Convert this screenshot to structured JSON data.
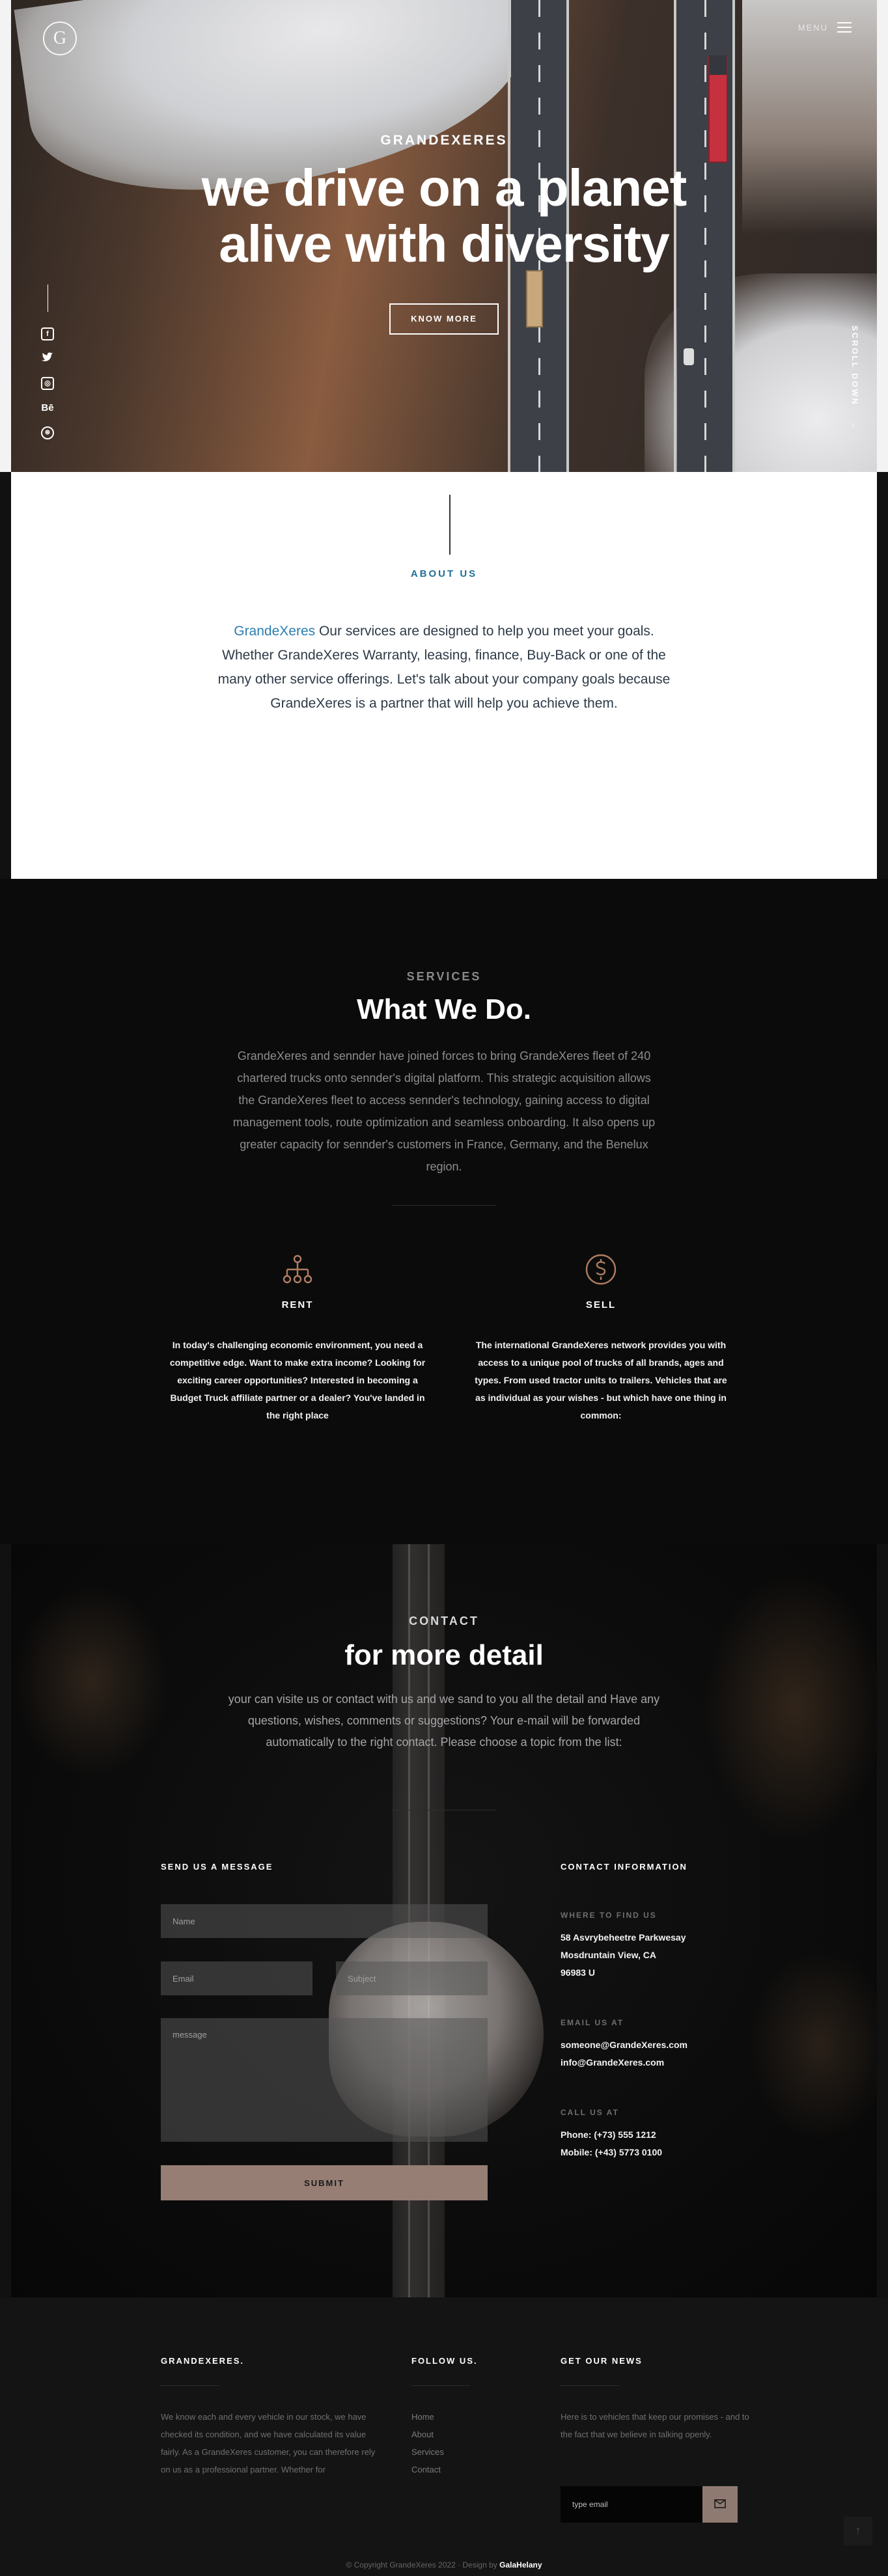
{
  "hero": {
    "brand": "GRANDEXERES",
    "title_line1": "we drive on a planet",
    "title_line2": "alive with diversity",
    "button": "KNOW MORE",
    "menu_label": "MENU",
    "logo_letter": "G",
    "scroll_label": "SCROLL DOWN",
    "scroll_arrow": "→",
    "social": [
      "facebook-icon",
      "twitter-icon",
      "instagram-icon",
      "behance-icon",
      "dribbble-icon"
    ],
    "social_glyphs": [
      "f",
      "🐦",
      "◎",
      "Bē",
      "⊛"
    ]
  },
  "about": {
    "label": "ABOUT US",
    "brand_word": "GrandeXeres",
    "text": " Our services are designed to help you meet your goals. Whether GrandeXeres Warranty, leasing, finance, Buy-Back or one of the many other service offerings. Let's talk about your company goals because GrandeXeres is a partner that will help you achieve them."
  },
  "services": {
    "eyebrow": "SERVICES",
    "title": "What We Do.",
    "lead": "GrandeXeres and sennder have joined forces to bring GrandeXeres fleet of 240 chartered trucks onto sennder's digital platform. This strategic acquisition allows the GrandeXeres fleet to access sennder's technology, gaining access to digital management tools, route optimization and seamless onboarding. It also opens up greater capacity for sennder's customers in France, Germany, and the Benelux region.",
    "items": [
      {
        "title": "RENT",
        "icon": "hierarchy-icon",
        "text": "In today's challenging economic environment, you need a competitive edge. Want to make extra income? Looking for exciting career opportunities? Interested in becoming a Budget Truck affiliate partner or a dealer? You've landed in the right place"
      },
      {
        "title": "SELL",
        "icon": "dollar-coin-icon",
        "text": "The international GrandeXeres network provides you with access to a unique pool of trucks of all brands, ages and types. From used tractor units to trailers. Vehicles that are as individual as your wishes - but which have one thing in common:"
      }
    ]
  },
  "contact": {
    "eyebrow": "CONTACT",
    "title": "for more detail",
    "lead": "your can visite us or contact with us and we sand to you all the detail and Have any questions, wishes, comments or suggestions? Your e-mail will be forwarded automatically to the right contact. Please choose a topic from the list:",
    "form": {
      "title": "SEND US A MESSAGE",
      "name_placeholder": "Name",
      "email_placeholder": "Email",
      "subject_placeholder": "Subject",
      "message_placeholder": "message",
      "submit": "SUBMIT"
    },
    "info": {
      "title": "CONTACT INFORMATION",
      "where_label": "WHERE TO FIND US",
      "address_1": "58 Asvrybeheetre Parkwesay",
      "address_2": "Mosdruntain View, CA",
      "address_3": "96983 U",
      "email_label": "EMAIL US AT",
      "email_1": "someone@GrandeXeres.com",
      "email_2": "info@GrandeXeres.com",
      "call_label": "CALL US AT",
      "phone": "Phone: (+73) 555 1212",
      "mobile": "Mobile: (+43) 5773 0100"
    }
  },
  "footer": {
    "col1_title": "GRANDEXERES.",
    "col1_text": "We know each and every vehicle in our stock, we have checked its condition, and we have calculated its value fairly. As a GrandeXeres customer, you can therefore rely on us as a professional partner. Whether for",
    "col2_title": "FOLLOW US.",
    "links": [
      "Home",
      "About",
      "Services",
      "Contact"
    ],
    "col3_title": "GET OUR NEWS",
    "col3_text": "Here is to vehicles that keep our promises - and to the fact that we believe in talking openly.",
    "news_placeholder": "type email",
    "to_top": "↑",
    "copyright": "© Copyright GrandeXeres 2022",
    "separator": " · ",
    "design_by": "Design by",
    "designer": "GalaHelany"
  },
  "colors": {
    "accent_blue": "#2a7db0",
    "accent_brown": "#967e75",
    "icon_brown": "#b07d62"
  }
}
